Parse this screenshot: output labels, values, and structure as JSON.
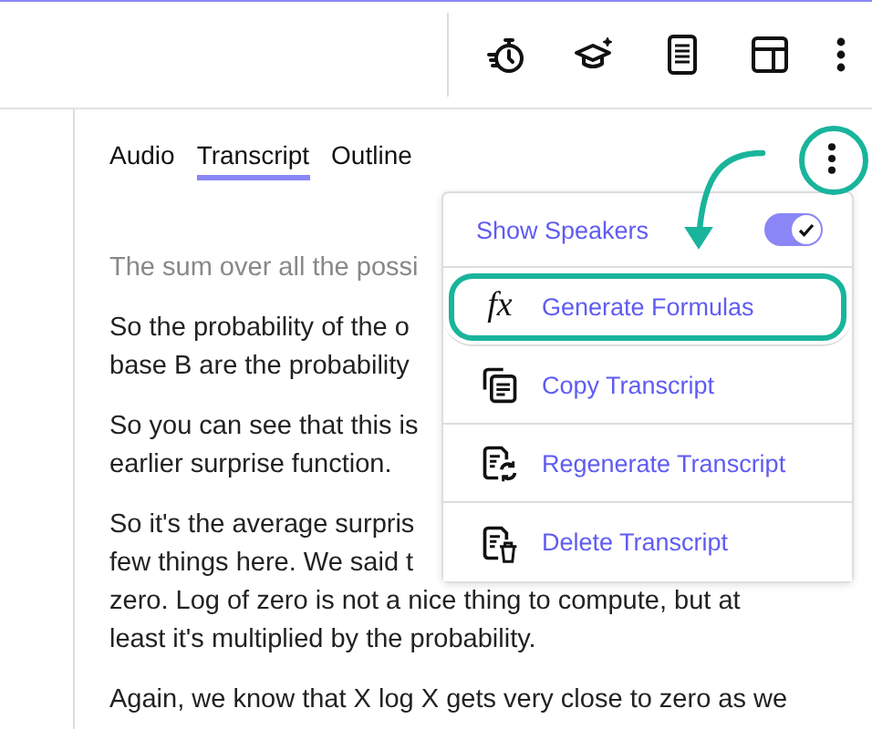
{
  "toolbar": {
    "icons": [
      {
        "kind": "timer"
      },
      {
        "kind": "cap"
      },
      {
        "kind": "document"
      },
      {
        "kind": "layout"
      },
      {
        "kind": "more"
      }
    ]
  },
  "tabs": [
    {
      "label": "Audio",
      "selected": false
    },
    {
      "label": "Transcript",
      "selected": true
    },
    {
      "label": "Outline",
      "selected": false
    }
  ],
  "transcript": {
    "paragraphs": [
      {
        "lines": [
          "The sum over all the possi"
        ],
        "faded": true
      },
      {
        "lines": [
          "So the probability of the o",
          "base B are the probability"
        ],
        "faded": false
      },
      {
        "lines": [
          "So you can see that this is",
          "earlier surprise function."
        ],
        "faded": false
      },
      {
        "lines": [
          "So it's the average surpris",
          "few things here. We said t",
          "zero. Log of zero is not a nice thing to compute, but at",
          "least it's multiplied by the probability."
        ],
        "faded": false
      },
      {
        "lines": [
          "Again, we know that X log X gets very close to zero as we"
        ],
        "faded": false
      }
    ]
  },
  "menu": {
    "toggle": {
      "label": "Show Speakers",
      "on": true
    },
    "items": [
      {
        "label": "Generate Formulas",
        "kind": "formula",
        "icon_text": "fx",
        "highlighted": true
      },
      {
        "label": "Copy Transcript",
        "kind": "copy",
        "highlighted": false
      },
      {
        "label": "Regenerate Transcript",
        "kind": "regenerate",
        "highlighted": false
      },
      {
        "label": "Delete Transcript",
        "kind": "delete",
        "highlighted": false
      }
    ]
  }
}
